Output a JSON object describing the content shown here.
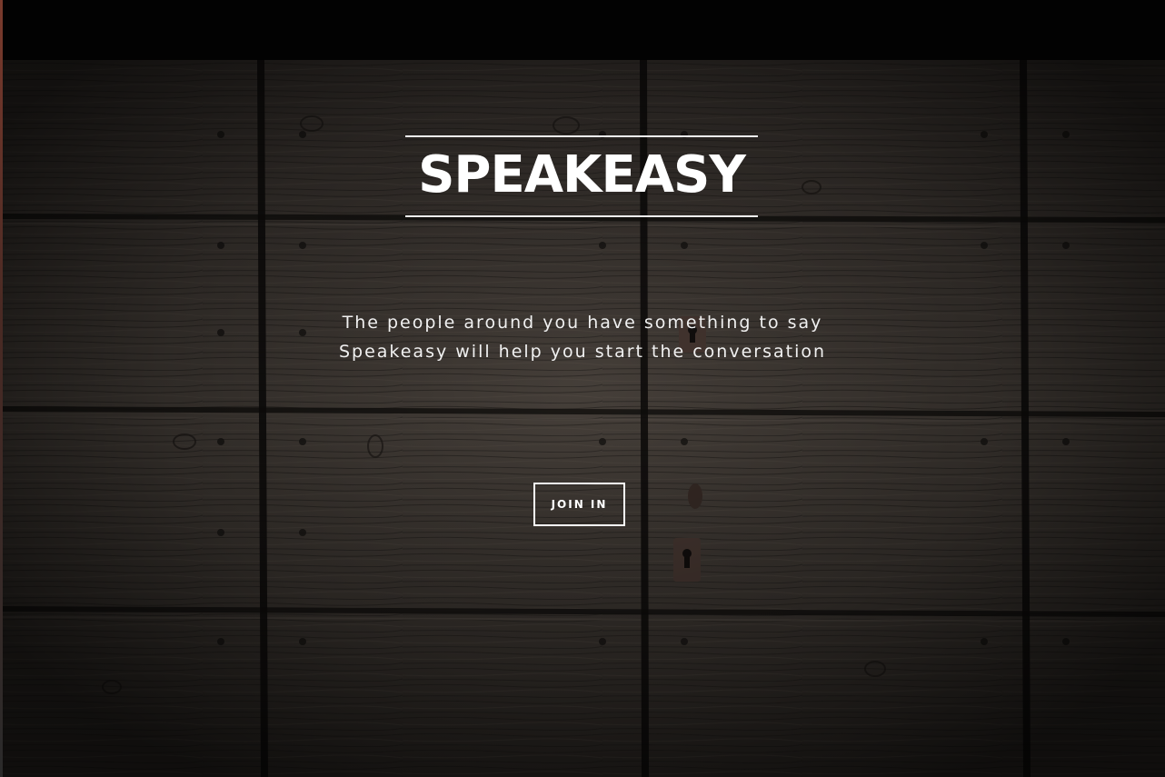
{
  "hero": {
    "title": "SPEAKEASY",
    "tagline": "The people around you have something to say Speakeasy will help you start the conversation",
    "cta_label": "JOIN IN",
    "background": "dark-wood-door-image"
  },
  "colors": {
    "text": "#ffffff",
    "wood_base": "#2e2925",
    "top_bar": "#020202"
  }
}
